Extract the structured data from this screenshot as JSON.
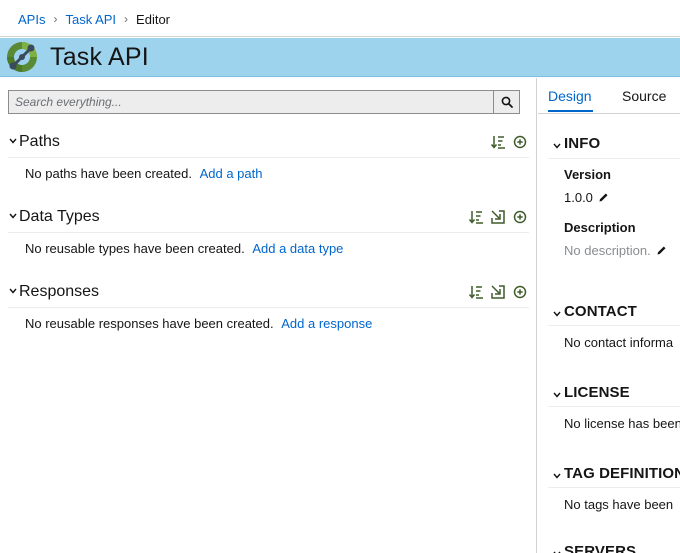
{
  "breadcrumb": {
    "items": [
      "APIs",
      "Task API"
    ],
    "current": "Editor",
    "separator": "›"
  },
  "header": {
    "title": "Task API",
    "logo_icon": "apicurio-logo-icon"
  },
  "search": {
    "placeholder": "Search everything...",
    "value": "",
    "icon": "search-icon"
  },
  "sections": {
    "paths": {
      "title": "Paths",
      "empty_text": "No paths have been created.",
      "link": "Add a path"
    },
    "data_types": {
      "title": "Data Types",
      "empty_text": "No reusable types have been created.",
      "link": "Add a data type"
    },
    "responses": {
      "title": "Responses",
      "empty_text": "No reusable responses have been created.",
      "link": "Add a response"
    }
  },
  "tabs": {
    "design": "Design",
    "source": "Source",
    "active": "Design"
  },
  "info": {
    "title": "INFO",
    "version_label": "Version",
    "version_value": "1.0.0",
    "description_label": "Description",
    "description_value": "No description."
  },
  "contact": {
    "title": "CONTACT",
    "text": "No contact informa"
  },
  "license": {
    "title": "LICENSE",
    "text": "No license has been"
  },
  "tags": {
    "title": "TAG DEFINITION",
    "text": "No tags have been"
  },
  "servers": {
    "title": "SERVERS"
  },
  "colors": {
    "accent": "#0066cc",
    "header_bg": "#9ed3ee",
    "icon_green": "#3f5c2a"
  }
}
